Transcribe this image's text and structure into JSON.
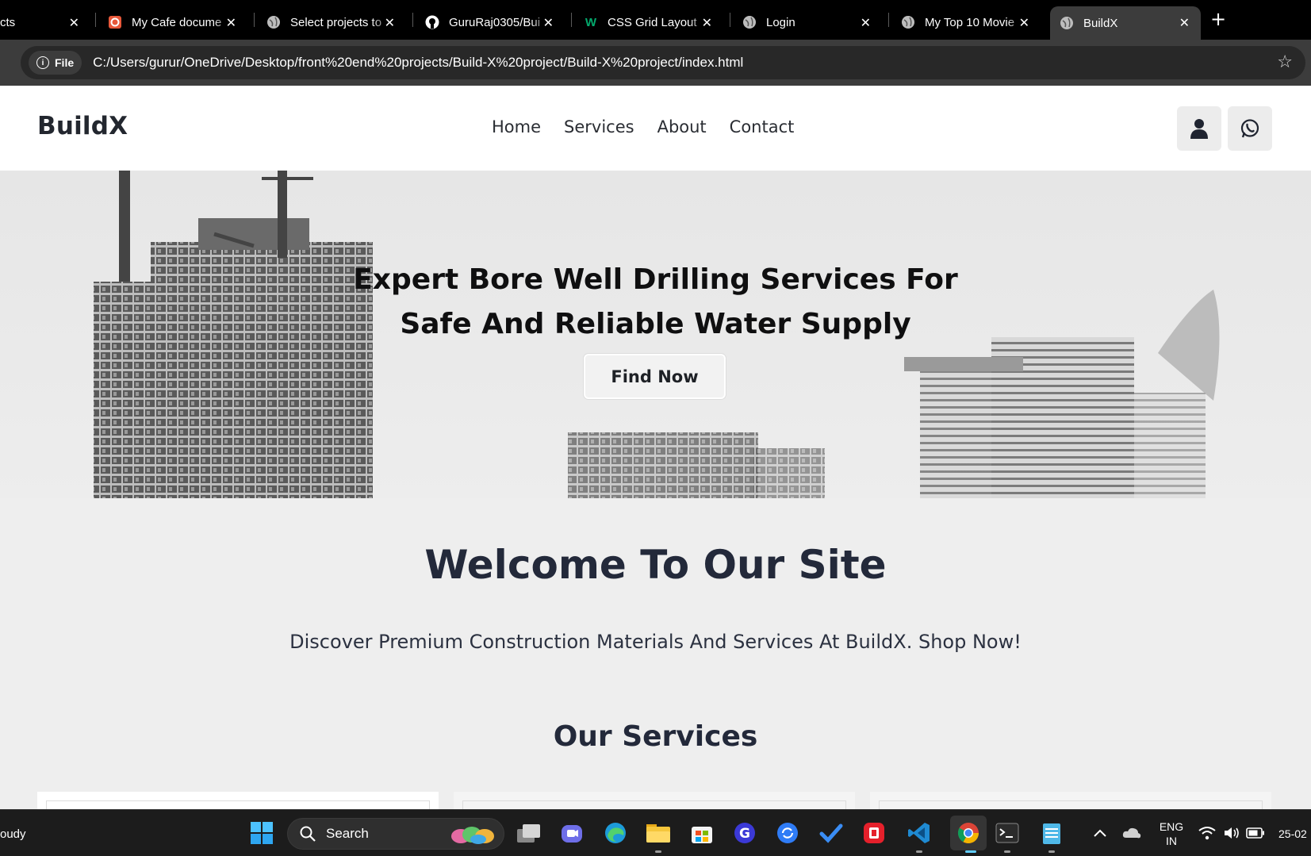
{
  "browser": {
    "tabs": [
      {
        "label": "cts",
        "icon": "page-icon"
      },
      {
        "label": "My Cafe docume",
        "icon": "app-favicon"
      },
      {
        "label": "Select projects to",
        "icon": "globe-icon"
      },
      {
        "label": "GuruRaj0305/Bui",
        "icon": "github-icon"
      },
      {
        "label": "CSS Grid Layout",
        "icon": "w3schools-icon"
      },
      {
        "label": "Login",
        "icon": "globe-icon"
      },
      {
        "label": "My Top 10 Movie",
        "icon": "globe-icon"
      },
      {
        "label": "BuildX",
        "icon": "globe-icon",
        "active": true
      }
    ],
    "address": {
      "scheme_label": "File",
      "url": "C:/Users/gurur/OneDrive/Desktop/front%20end%20projects/Build-X%20project/Build-X%20project/index.html"
    }
  },
  "site": {
    "brand": "BuildX",
    "nav": [
      "Home",
      "Services",
      "About",
      "Contact"
    ],
    "hero": {
      "title_line1": "Expert Bore Well Drilling Services For",
      "title_line2": "Safe And Reliable Water Supply",
      "button": "Find Now"
    },
    "welcome_title": "Welcome To Our Site",
    "welcome_sub": "Discover Premium Construction Materials And Services At BuildX. Shop Now!",
    "services_title": "Our Services"
  },
  "taskbar": {
    "weather_text": "oudy",
    "search_label": "Search",
    "lang_line1": "ENG",
    "lang_line2": "IN",
    "date_partial": "25-02"
  },
  "colors": {
    "chrome_bg": "#000000",
    "active_tab": "#3c3c3c",
    "page_bg": "#eeeeee",
    "heading": "#23293a"
  }
}
